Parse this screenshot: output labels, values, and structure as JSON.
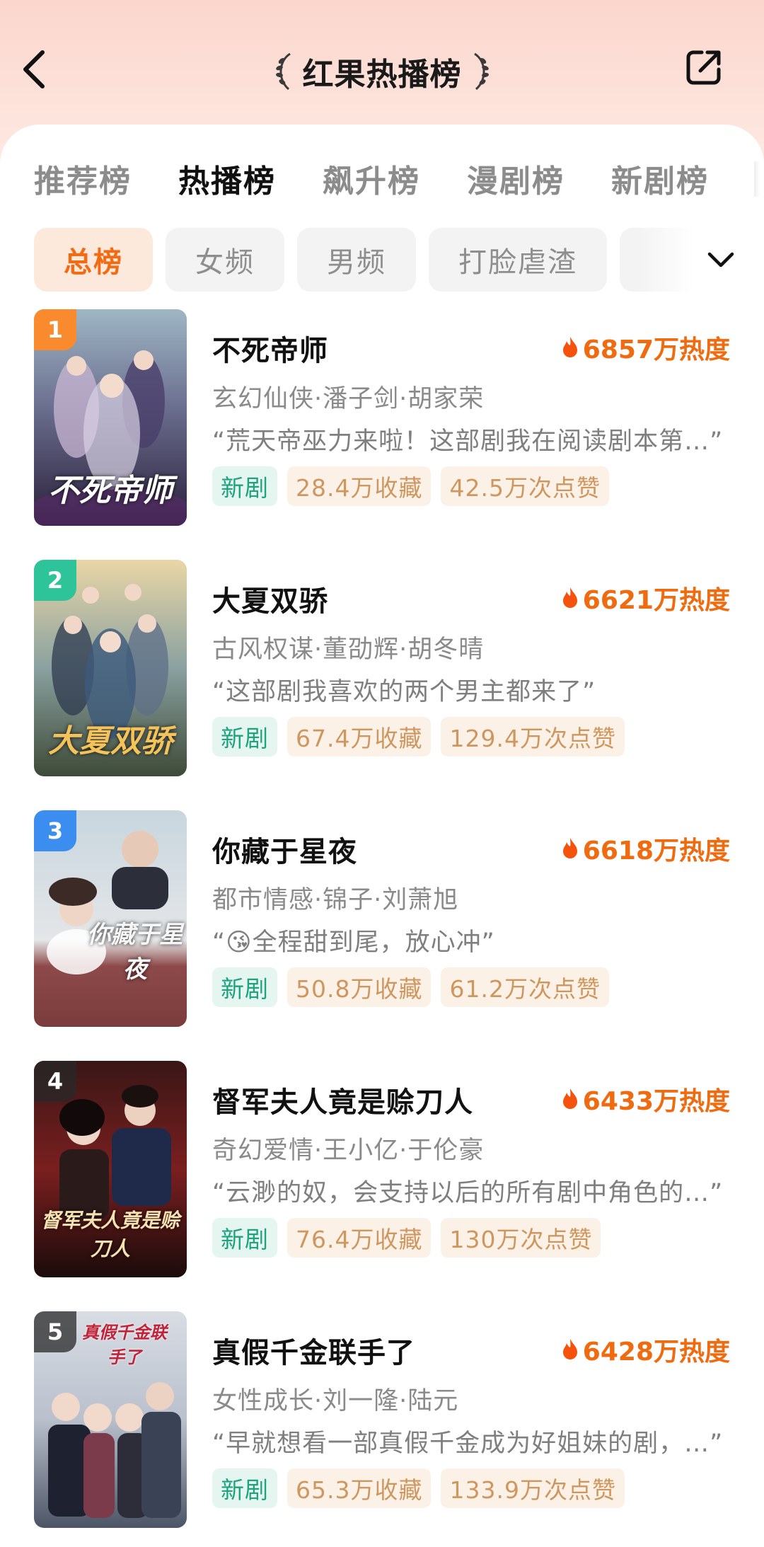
{
  "header": {
    "title": "红果热播榜",
    "back_icon": "chevron-left-icon",
    "share_icon": "share-out-icon"
  },
  "tabs": [
    {
      "label": "推荐榜",
      "active": false
    },
    {
      "label": "热播榜",
      "active": true
    },
    {
      "label": "飙升榜",
      "active": false
    },
    {
      "label": "漫剧榜",
      "active": false
    },
    {
      "label": "新剧榜",
      "active": false
    }
  ],
  "chips": [
    {
      "label": "总榜",
      "active": true
    },
    {
      "label": "女频",
      "active": false
    },
    {
      "label": "男频",
      "active": false
    },
    {
      "label": "打脸虐渣",
      "active": false
    }
  ],
  "colors": {
    "accent_orange": "#f06a0f",
    "new_tag_green": "#1fa27e",
    "stat_tag_tan": "#cf9760",
    "rank1_badge": "#f98a2d",
    "rank2_badge": "#2ec49a",
    "rank3_badge": "#3b8ef0",
    "rank_other_badge": "#5a5a5a"
  },
  "items": [
    {
      "rank": "1",
      "title": "不死帝师",
      "poster_title": "不死帝师",
      "heat": "6857万热度",
      "meta": "玄幻仙侠·潘子剑·胡家荣",
      "quote": "“荒天帝巫力来啦！这部剧我在阅读剧本第…”",
      "tag_new": "新剧",
      "favorites": "28.4万收藏",
      "likes": "42.5万次点赞"
    },
    {
      "rank": "2",
      "title": "大夏双骄",
      "poster_title": "大夏双骄",
      "heat": "6621万热度",
      "meta": "古风权谋·董劭辉·胡冬晴",
      "quote": "“这部剧我喜欢的两个男主都来了”",
      "tag_new": "新剧",
      "favorites": "67.4万收藏",
      "likes": "129.4万次点赞"
    },
    {
      "rank": "3",
      "title": "你藏于星夜",
      "poster_title": "你藏于星夜",
      "heat": "6618万热度",
      "meta": "都市情感·锦子·刘萧旭",
      "quote": "“😘全程甜到尾，放心冲”",
      "tag_new": "新剧",
      "favorites": "50.8万收藏",
      "likes": "61.2万次点赞"
    },
    {
      "rank": "4",
      "title": "督军夫人竟是赊刀人",
      "poster_title": "督军夫人竟是赊刀人",
      "heat": "6433万热度",
      "meta": "奇幻爱情·王小亿·于伦豪",
      "quote": "“云渺的奴，会支持以后的所有剧中角色的…”",
      "tag_new": "新剧",
      "favorites": "76.4万收藏",
      "likes": "130万次点赞"
    },
    {
      "rank": "5",
      "title": "真假千金联手了",
      "poster_title": "真假千金联手了",
      "heat": "6428万热度",
      "meta": "女性成长·刘一隆·陆元",
      "quote": "“早就想看一部真假千金成为好姐妹的剧，…”",
      "tag_new": "新剧",
      "favorites": "65.3万收藏",
      "likes": "133.9万次点赞"
    }
  ]
}
